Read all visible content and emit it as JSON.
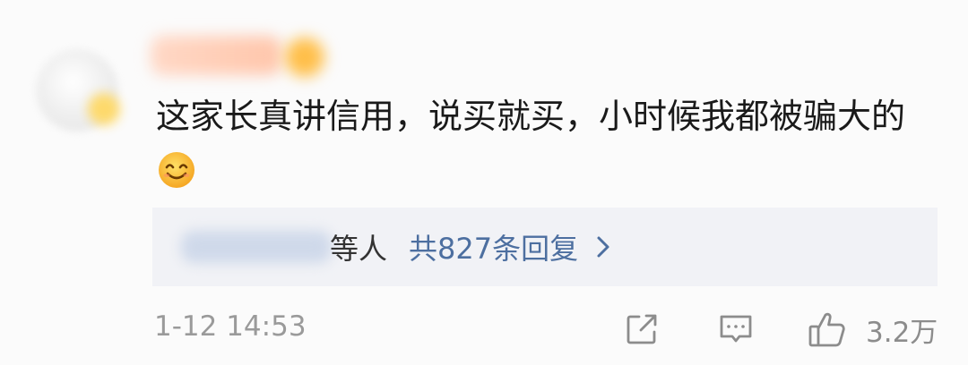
{
  "comment": {
    "text": "这家长真讲信用，说买就买，小时候我都被骗大的",
    "emoji": "smiling-face-emoji"
  },
  "replies": {
    "suffix": "等人",
    "link_text": "共827条回复",
    "chevron_icon": "chevron-right-icon"
  },
  "footer": {
    "timestamp": "1-12 14:53",
    "forward_icon": "share-icon",
    "comment_icon": "comment-icon",
    "like_icon": "thumbs-up-icon",
    "like_count": "3.2万"
  },
  "colors": {
    "link": "#4d6fa0",
    "text": "#1a1a1a",
    "muted": "#9a9a9a",
    "reply_bg": "#f1f2f6"
  }
}
